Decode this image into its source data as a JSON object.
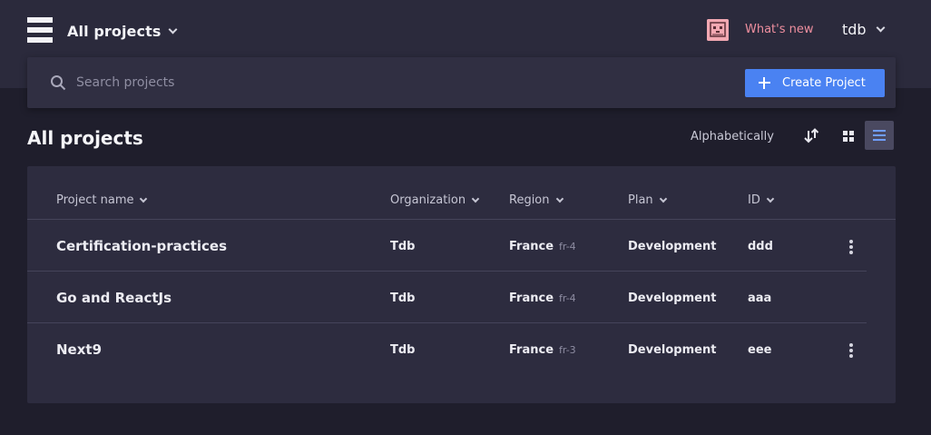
{
  "header": {
    "scope_label": "All projects",
    "whats_new": "What's new",
    "username": "tdb"
  },
  "search": {
    "placeholder": "Search projects",
    "value": ""
  },
  "create_button": "Create Project",
  "page": {
    "title": "All projects",
    "sort_label": "Alphabetically",
    "active_view": "list"
  },
  "table": {
    "columns": [
      "Project name",
      "Organization",
      "Region",
      "Plan",
      "ID"
    ],
    "rows": [
      {
        "name": "Certification-practices",
        "organization": "Tdb",
        "region": "France",
        "region_code": "fr-4",
        "plan": "Development",
        "id": "ddd",
        "has_menu": true
      },
      {
        "name": "Go and ReactJs",
        "organization": "Tdb",
        "region": "France",
        "region_code": "fr-4",
        "plan": "Development",
        "id": "aaa",
        "has_menu": false
      },
      {
        "name": "Next9",
        "organization": "Tdb",
        "region": "France",
        "region_code": "fr-3",
        "plan": "Development",
        "id": "eee",
        "has_menu": true
      }
    ]
  },
  "colors": {
    "accent": "#4a82f2",
    "whats_new": "#ef8f9f",
    "background": "#1f1e2c",
    "card": "#2d2c3f"
  },
  "icons": [
    "menu-logo-icon",
    "chevron-down-icon",
    "avatar-cat-icon",
    "search-icon",
    "plus-icon",
    "sort-direction-icon",
    "grid-view-icon",
    "list-view-icon",
    "more-vertical-icon"
  ]
}
